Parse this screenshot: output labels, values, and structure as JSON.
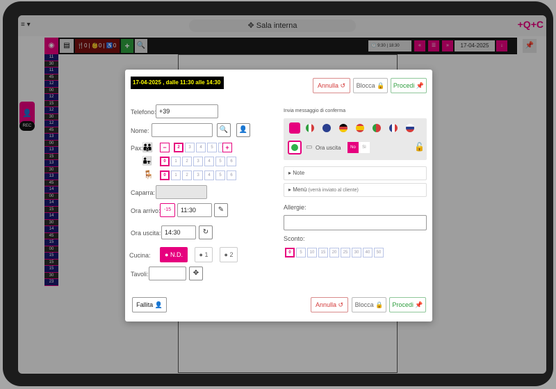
{
  "topbar": {
    "menu_label": "≡ ▾",
    "room_title": "Sala interna",
    "room_icon": "move-icon",
    "logo": "+Q+",
    "logo_accent": "C"
  },
  "toolbar": {
    "eye_label": "◉",
    "counts": "🍴0 | 👶0 | ♿0",
    "plus": "+",
    "search_icon": "🔍",
    "time_range": "🕐 9:30 | 18:30",
    "nav_prev": "«",
    "nav_list": "☰",
    "nav_next": "»",
    "date": "17-04-2025",
    "nav_today": "↓",
    "pin_icon": "📌"
  },
  "sidebar_slots": [
    "11",
    "30",
    "11",
    "45",
    "12",
    "00",
    "12",
    "15",
    "12",
    "30",
    "12",
    "45",
    "13",
    "00",
    "13",
    "15",
    "13",
    "30",
    "13",
    "45",
    "14",
    "00",
    "14",
    "15",
    "14",
    "30",
    "14",
    "45",
    "15",
    "00",
    "15",
    "15",
    "15",
    "30",
    "23"
  ],
  "left_widget": {
    "icon": "👤",
    "rec_label": "REC"
  },
  "modal": {
    "banner": "17-04-2025 , dalle 11:30 alle 14:30",
    "annulla": "Annulla ↺",
    "blocca": "Blocca 🔒",
    "procedi": "Procedi 📌",
    "telefono_label": "Telefono:",
    "telefono_value": "+39",
    "nome_label": "Nome:",
    "nome_value": "",
    "pax_label": "Pax:",
    "pax_minus": "−",
    "pax_plus": "+",
    "pax_row1": [
      "2",
      "3",
      "4",
      "5",
      "6"
    ],
    "pax_row2": [
      "0",
      "1",
      "2",
      "3",
      "4",
      "5",
      "6"
    ],
    "pax_row3": [
      "0",
      "1",
      "2",
      "3",
      "4",
      "5",
      "6"
    ],
    "caparra_label": "Caparra:",
    "ora_arrivo_label": "Ora arrivo:",
    "ora_arrivo_minus": "-15",
    "ora_arrivo_value": "11:30",
    "ora_uscita_label": "Ora uscita:",
    "ora_uscita_value": "14:30",
    "cucina_label": "Cucina:",
    "cucina_nd": "● N.D.",
    "cucina_1": "● 1",
    "cucina_2": "● 2",
    "tavoli_label": "Tavoli:",
    "fallita": "Fallita 👤",
    "conferma_label": "Invia messaggio di conferma",
    "ora_uscita_toggle": "Ora uscita",
    "toggle_no": "No",
    "toggle_si": "Sì",
    "note_label": "Note",
    "menu_label": "Menù",
    "menu_hint": "(verrà inviato al cliente)",
    "allergie_label": "Allergie:",
    "sconto_label": "Sconto:",
    "sconto_values": [
      "0",
      "5",
      "10",
      "15",
      "20",
      "25",
      "30",
      "40",
      "50"
    ]
  },
  "colors": {
    "accent": "#e6007e",
    "success": "#2e9e3e",
    "danger": "#d43c3c"
  }
}
